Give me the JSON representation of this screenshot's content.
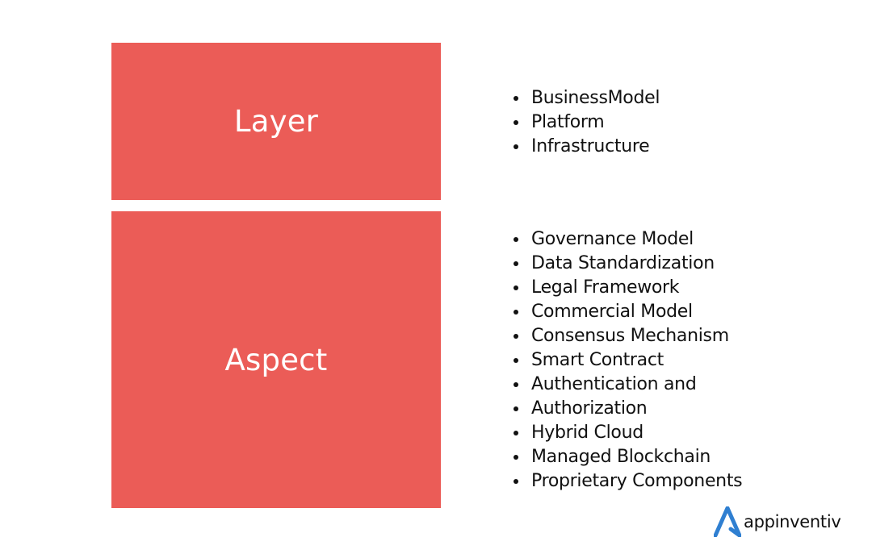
{
  "colors": {
    "box_fill": "#EB5C57",
    "box_text": "#FFFFFF",
    "list_text": "#111111",
    "logo_accent": "#2F7FD1"
  },
  "sections": [
    {
      "label": "Layer",
      "items": [
        "BusinessModel",
        "Platform",
        "Infrastructure"
      ]
    },
    {
      "label": "Aspect",
      "items": [
        "Governance Model",
        "Data Standardization",
        "Legal Framework",
        "Commercial Model",
        "Consensus Mechanism",
        "Smart Contract",
        "Authentication and",
        "Authorization",
        "Hybrid Cloud",
        "Managed Blockchain",
        "Proprietary Components"
      ]
    }
  ],
  "logo": {
    "icon": "appinventiv-a-logo-icon",
    "text": "appinventiv"
  }
}
